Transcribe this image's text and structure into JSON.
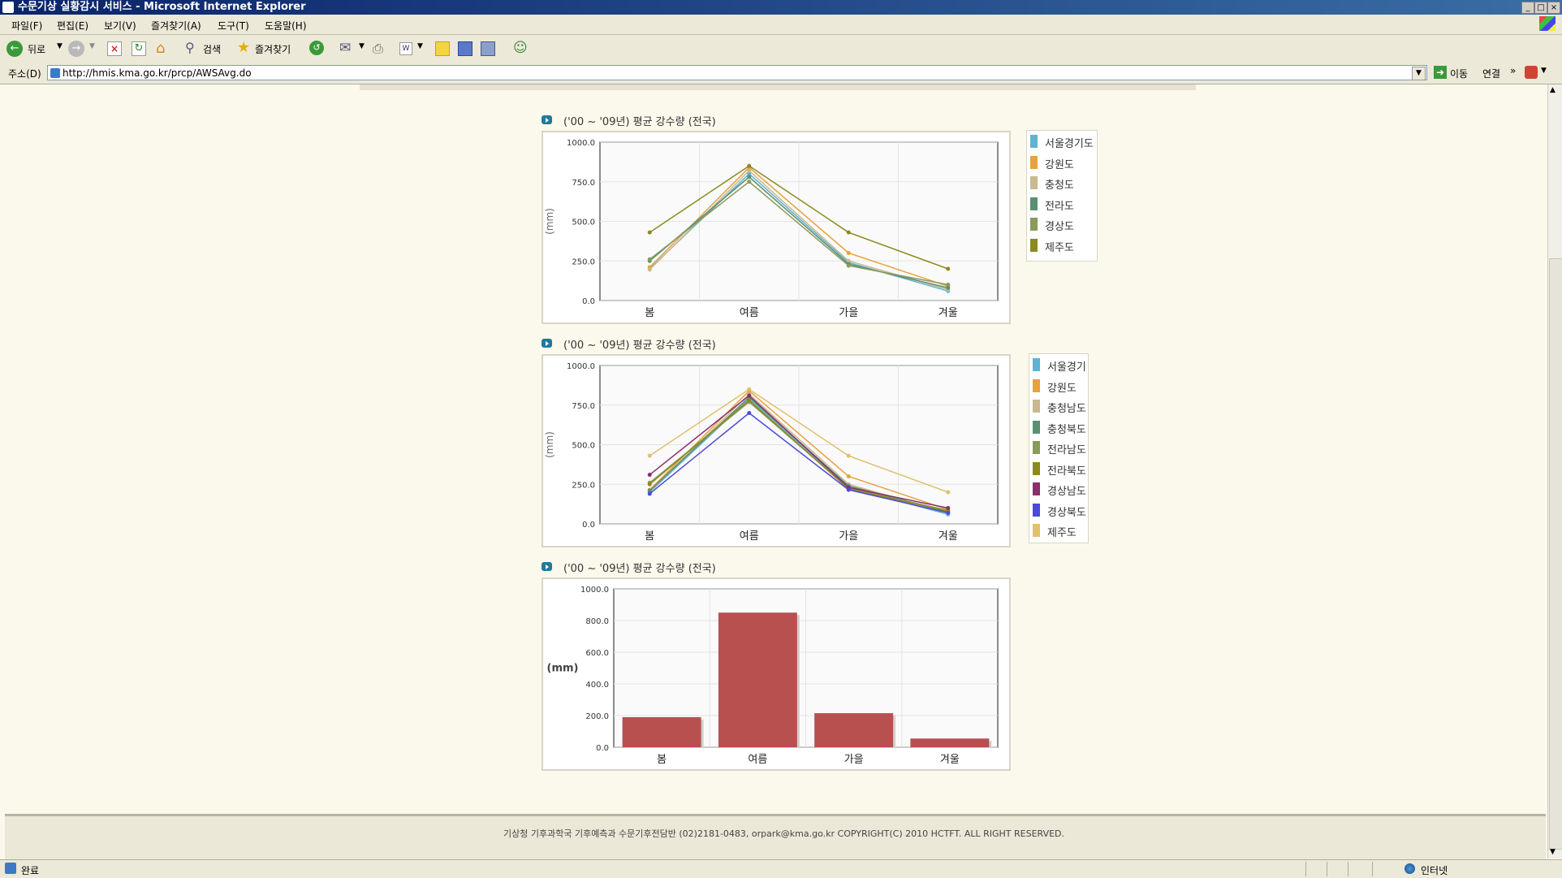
{
  "window": {
    "title": "수문기상 실황감시 서비스 - Microsoft Internet Explorer"
  },
  "menu": [
    "파일(F)",
    "편집(E)",
    "보기(V)",
    "즐겨찾기(A)",
    "도구(T)",
    "도움말(H)"
  ],
  "toolbar": {
    "back_label": "뒤로",
    "search_label": "검색",
    "favorites_label": "즐겨찾기"
  },
  "address": {
    "label": "주소(D)",
    "url": "http://hmis.kma.go.kr/prcp/AWSAvg.do",
    "go_label": "이동",
    "links_label": "연결"
  },
  "sections": [
    {
      "title": "('00 ~ '09년) 평균 강수량 (전국)"
    },
    {
      "title": "('00 ~ '09년) 평균 강수량 (전국)"
    },
    {
      "title": "('00 ~ '09년) 평균 강수량 (전국)"
    }
  ],
  "footer": {
    "text": "기상청 기후과학국 기후예측과 수문기후전담반  (02)2181-0483, orpark@kma.go.kr   COPYRIGHT(C) 2010 HCTFT. ALL RIGHT RESERVED."
  },
  "status": {
    "left": "완료",
    "zone": "인터넷"
  },
  "chart_data": [
    {
      "type": "line",
      "categories": [
        "봄",
        "여름",
        "가을",
        "겨울"
      ],
      "ylabel": "(mm)",
      "ylim": [
        0,
        1000
      ],
      "yticks": [
        "0.0",
        "250.0",
        "500.0",
        "750.0",
        "1000.0"
      ],
      "legend": "right",
      "series": [
        {
          "name": "서울경기도",
          "color": "#5fb3cf",
          "values": [
            200,
            800,
            240,
            60
          ]
        },
        {
          "name": "강원도",
          "color": "#e8a040",
          "values": [
            210,
            840,
            300,
            90
          ]
        },
        {
          "name": "충청도",
          "color": "#c9b98f",
          "values": [
            195,
            820,
            250,
            70
          ]
        },
        {
          "name": "전라도",
          "color": "#5a8f72",
          "values": [
            250,
            780,
            230,
            80
          ]
        },
        {
          "name": "경상도",
          "color": "#8a9a5a",
          "values": [
            260,
            750,
            220,
            100
          ]
        },
        {
          "name": "제주도",
          "color": "#8b8a1e",
          "values": [
            430,
            850,
            430,
            200
          ]
        }
      ]
    },
    {
      "type": "line",
      "categories": [
        "봄",
        "여름",
        "가을",
        "겨울"
      ],
      "ylabel": "(mm)",
      "ylim": [
        0,
        1000
      ],
      "yticks": [
        "0.0",
        "250.0",
        "500.0",
        "750.0",
        "1000.0"
      ],
      "legend": "right",
      "series": [
        {
          "name": "서울경기",
          "color": "#5fb3cf",
          "values": [
            200,
            790,
            230,
            60
          ]
        },
        {
          "name": "강원도",
          "color": "#e8a040",
          "values": [
            215,
            840,
            300,
            90
          ]
        },
        {
          "name": "충청남도",
          "color": "#c9b98f",
          "values": [
            205,
            820,
            250,
            70
          ]
        },
        {
          "name": "충청북도",
          "color": "#5a8f72",
          "values": [
            210,
            800,
            240,
            75
          ]
        },
        {
          "name": "전라남도",
          "color": "#8a9a5a",
          "values": [
            260,
            770,
            225,
            85
          ]
        },
        {
          "name": "전라북도",
          "color": "#8b8a1e",
          "values": [
            250,
            780,
            220,
            80
          ]
        },
        {
          "name": "경상남도",
          "color": "#8b2f6b",
          "values": [
            310,
            810,
            230,
            100
          ]
        },
        {
          "name": "경상북도",
          "color": "#4a4ad8",
          "values": [
            190,
            700,
            215,
            70
          ]
        },
        {
          "name": "제주도",
          "color": "#e0c070",
          "values": [
            430,
            850,
            430,
            200
          ]
        }
      ]
    },
    {
      "type": "bar",
      "categories": [
        "봄",
        "여름",
        "가을",
        "겨울"
      ],
      "values": [
        190,
        850,
        215,
        55
      ],
      "ylabel": "(mm)",
      "ylim": [
        0,
        1000
      ],
      "yticks": [
        "0.0",
        "200.0",
        "400.0",
        "600.0",
        "800.0",
        "1000.0"
      ],
      "color": "#b85050"
    }
  ]
}
